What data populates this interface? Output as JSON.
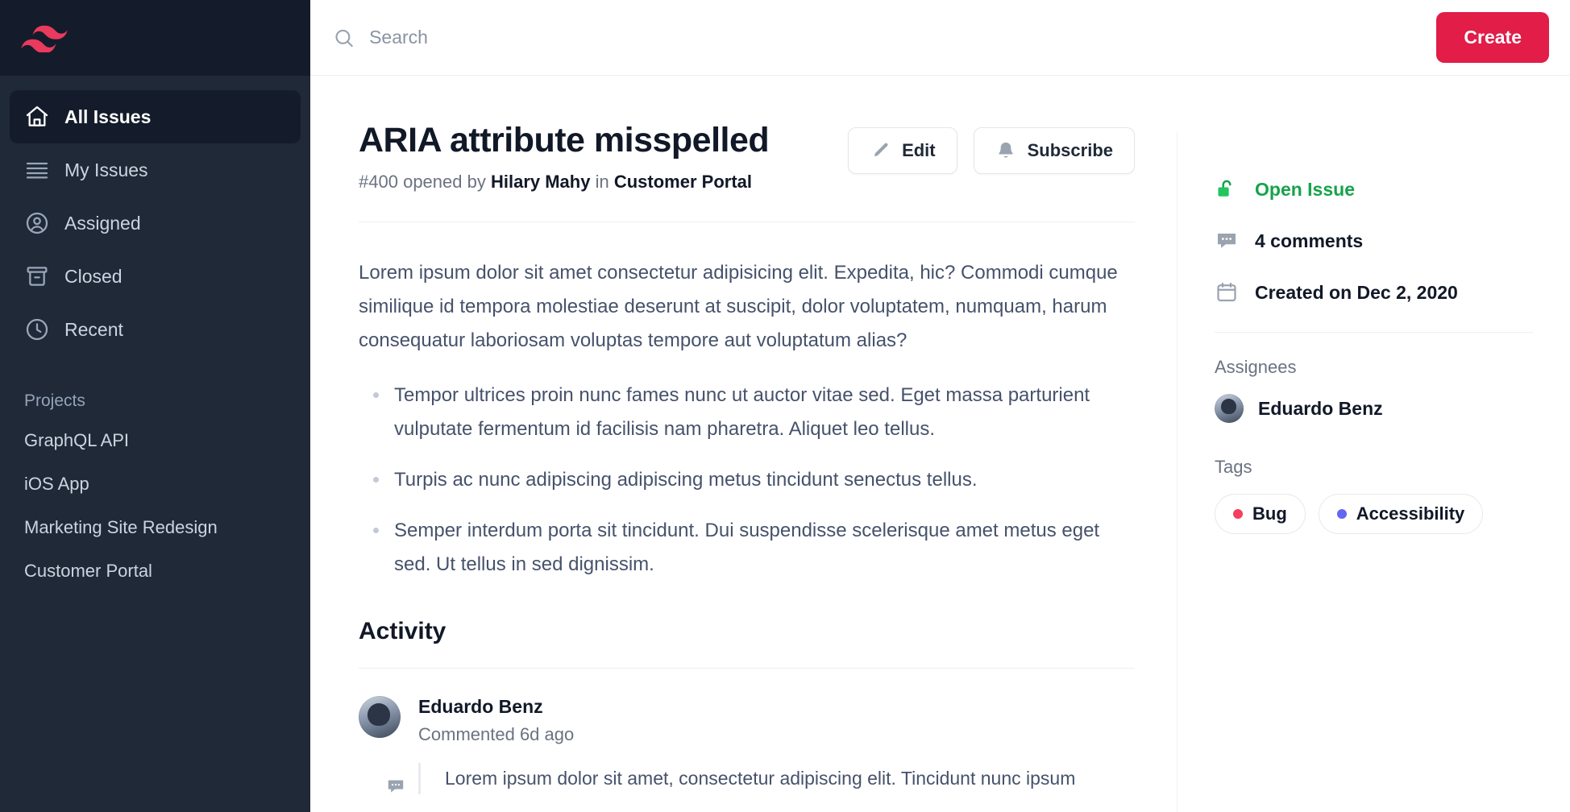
{
  "brand": {
    "logo_icon": "tailwind-wave-logo",
    "logo_color": "#ea3a5e"
  },
  "sidebar": {
    "items": [
      {
        "label": "All Issues",
        "icon": "home-icon",
        "active": true
      },
      {
        "label": "My Issues",
        "icon": "list-icon",
        "active": false
      },
      {
        "label": "Assigned",
        "icon": "user-circle-icon",
        "active": false
      },
      {
        "label": "Closed",
        "icon": "archive-icon",
        "active": false
      },
      {
        "label": "Recent",
        "icon": "clock-icon",
        "active": false
      }
    ],
    "projects_heading": "Projects",
    "projects": [
      {
        "label": "GraphQL API"
      },
      {
        "label": "iOS App"
      },
      {
        "label": "Marketing Site Redesign"
      },
      {
        "label": "Customer Portal"
      }
    ]
  },
  "topbar": {
    "search": {
      "placeholder": "Search",
      "value": "",
      "icon": "search-icon"
    },
    "create_label": "Create",
    "create_color": "#e11d48"
  },
  "issue": {
    "title": "ARIA attribute misspelled",
    "meta": {
      "number": "#400",
      "opened_by_prefix": "opened by",
      "author": "Hilary Mahy",
      "in_word": "in",
      "project": "Customer Portal"
    },
    "actions": [
      {
        "label": "Edit",
        "icon": "pencil-icon"
      },
      {
        "label": "Subscribe",
        "icon": "bell-icon"
      }
    ],
    "body_paragraph": "Lorem ipsum dolor sit amet consectetur adipisicing elit. Expedita, hic? Commodi cumque similique id tempora molestiae deserunt at suscipit, dolor voluptatem, numquam, harum consequatur laboriosam voluptas tempore aut voluptatum alias?",
    "bullets": [
      "Tempor ultrices proin nunc fames nunc ut auctor vitae sed. Eget massa parturient vulputate fermentum id facilisis nam pharetra. Aliquet leo tellus.",
      "Turpis ac nunc adipiscing adipiscing metus tincidunt senectus tellus.",
      "Semper interdum porta sit tincidunt. Dui suspendisse scelerisque amet metus eget sed. Ut tellus in sed dignissim."
    ]
  },
  "activity": {
    "heading": "Activity",
    "comments": [
      {
        "author": "Eduardo Benz",
        "meta": "Commented 6d ago",
        "avatar_icon": "user-avatar",
        "badge_icon": "comment-icon",
        "text": "Lorem ipsum dolor sit amet, consectetur adipiscing elit. Tincidunt nunc ipsum"
      }
    ]
  },
  "rail": {
    "status": {
      "label": "Open Issue",
      "icon": "lock-open-icon",
      "color": "#16a34a"
    },
    "comments": {
      "label": "4 comments",
      "icon": "chat-bubble-icon"
    },
    "created": {
      "label": "Created on Dec 2, 2020",
      "icon": "calendar-icon"
    },
    "assignees_label": "Assignees",
    "assignees": [
      {
        "name": "Eduardo Benz",
        "avatar_icon": "user-avatar"
      }
    ],
    "tags_label": "Tags",
    "tags": [
      {
        "label": "Bug",
        "color": "#f43f5e"
      },
      {
        "label": "Accessibility",
        "color": "#6366f1"
      }
    ]
  }
}
